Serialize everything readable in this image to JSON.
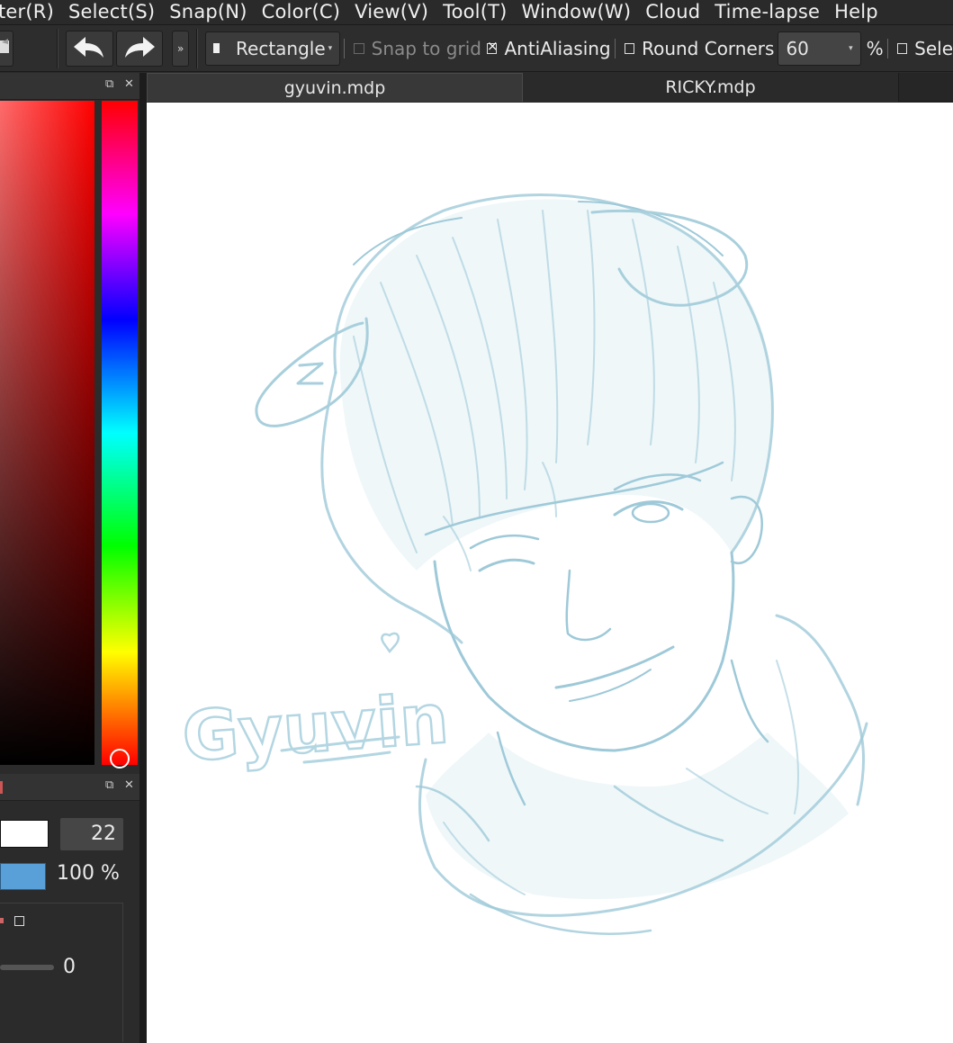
{
  "menu": [
    "ter(R)",
    "Select(S)",
    "Snap(N)",
    "Color(C)",
    "View(V)",
    "Tool(T)",
    "Window(W)",
    "Cloud",
    "Time-lapse",
    "Help"
  ],
  "toolbar": {
    "shape_select": "Rectangle",
    "snap_to_grid": "Snap to grid",
    "antialiasing": "AntiAliasing",
    "round_corners": "Round Corners",
    "round_corners_value": "60",
    "percent": "%",
    "select_partial": "Sele"
  },
  "tabs": [
    {
      "label": "gyuvin.mdp",
      "active": true
    },
    {
      "label": "RICKY.mdp",
      "active": false
    }
  ],
  "brush_panel": {
    "size_value": "22",
    "opacity_label": "100 %",
    "slider_value": "0"
  },
  "canvas": {
    "signature": "Gyuvin"
  },
  "colors": {
    "accent_blue": "#5aa0d8",
    "sketch_blue": "#8cc0d4"
  },
  "icons": [
    "pen-icon",
    "undo-icon",
    "redo-icon",
    "more-icon",
    "rectangle-icon",
    "popout-icon",
    "close-icon"
  ]
}
